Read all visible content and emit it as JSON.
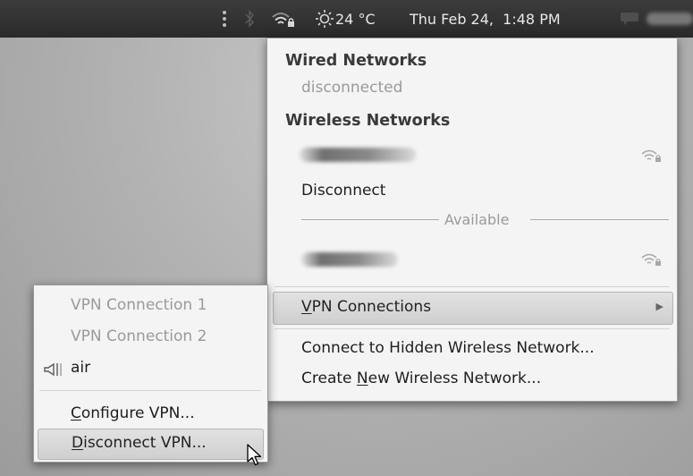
{
  "panel": {
    "weather_temp": "24 °C",
    "datetime": "Thu Feb 24,  1:48 PM"
  },
  "network_menu": {
    "wired_header": "Wired Networks",
    "wired_status": "disconnected",
    "wireless_header": "Wireless Networks",
    "disconnect_label": "Disconnect",
    "available_label": "Available",
    "vpn_connections_label": "VPN Connections",
    "vpn_connections_mnemonic": "V",
    "vpn_connections_rest": "PN Connections",
    "connect_hidden_label": "Connect to Hidden Wireless Network...",
    "create_new_pre": "Create ",
    "create_new_mnemonic": "N",
    "create_new_post": "ew Wireless Network...",
    "submenu_arrow": "▶"
  },
  "vpn_submenu": {
    "items": [
      {
        "label": "VPN Connection 1"
      },
      {
        "label": "VPN Connection 2"
      }
    ],
    "active_label": "air",
    "configure_mnemonic": "C",
    "configure_rest": "onfigure VPN...",
    "disconnect_mnemonic": "D",
    "disconnect_rest": "isconnect VPN..."
  },
  "icons": {
    "panel": [
      "menu-dots-icon",
      "bluetooth-icon",
      "wifi-locked-icon",
      "weather-icon",
      "chat-icon"
    ],
    "network_strength": "wifi-locked-icon",
    "vpn_active": "speaker-icon",
    "cursor": "mouse-pointer-icon"
  }
}
